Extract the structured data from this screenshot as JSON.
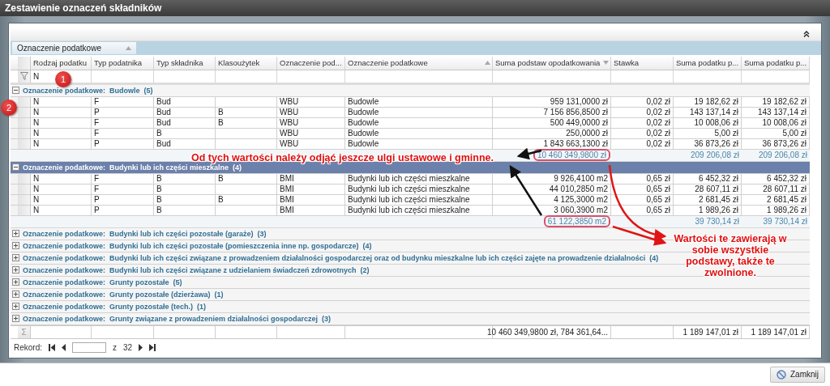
{
  "window": {
    "title": "Zestawienie oznaczeń składników"
  },
  "group_panel": {
    "label": "Oznaczenie podatkowe",
    "sort_ascending": true
  },
  "table": {
    "columns": [
      {
        "label": "Rodzaj podatku"
      },
      {
        "label": "Typ podatnika"
      },
      {
        "label": "Typ składnika"
      },
      {
        "label": "Klasoużytek"
      },
      {
        "label": "Oznaczenie pod..."
      },
      {
        "label": "Oznaczenie podatkowe",
        "sort_ascending": true
      },
      {
        "label": "Suma podstaw opodatkowania",
        "sort_ascending": false
      },
      {
        "label": "Stawka"
      },
      {
        "label": "Suma podatku p..."
      },
      {
        "label": "Suma podatku p..."
      }
    ],
    "filter": {
      "value": "N"
    },
    "groups": [
      {
        "title": "Oznaczenie podatkowe:  Budowle  (5)",
        "expanded": true,
        "selected": false,
        "rows": [
          {
            "rodzaj_podatku": "N",
            "typ_podatnika": "F",
            "typ_skladnika": "Bud",
            "column_5": "WBU",
            "oznaczenie_podatkowe": "Budowle",
            "suma_podstaw": "959 131,0000 zł",
            "stawka": "0,02 zł",
            "suma_podatku_1": "19 182,62 zł",
            "suma_podatku_2": "19 182,62 zł"
          },
          {
            "rodzaj_podatku": "N",
            "typ_podatnika": "P",
            "typ_skladnika": "Bud",
            "klasouzytek": "B",
            "column_5": "WBU",
            "oznaczenie_podatkowe": "Budowle",
            "suma_podstaw": "7 156 856,8500 zł",
            "stawka": "0,02 zł",
            "suma_podatku_1": "143 137,14 zł",
            "suma_podatku_2": "143 137,14 zł"
          },
          {
            "rodzaj_podatku": "N",
            "typ_podatnika": "F",
            "typ_skladnika": "Bud",
            "klasouzytek": "B",
            "column_5": "WBU",
            "oznaczenie_podatkowe": "Budowle",
            "suma_podstaw": "500 449,0000 zł",
            "stawka": "0,02 zł",
            "suma_podatku_1": "10 008,06 zł",
            "suma_podatku_2": "10 008,06 zł"
          },
          {
            "rodzaj_podatku": "N",
            "typ_podatnika": "F",
            "typ_skladnika": "B",
            "column_5": "WBU",
            "oznaczenie_podatkowe": "Budowle",
            "suma_podstaw": "250,0000 zł",
            "stawka": "0,02 zł",
            "suma_podatku_1": "5,00 zł",
            "suma_podatku_2": "5,00 zł"
          },
          {
            "rodzaj_podatku": "N",
            "typ_podatnika": "P",
            "typ_skladnika": "Bud",
            "column_5": "WBU",
            "oznaczenie_podatkowe": "Budowle",
            "suma_podstaw": "1 843 663,1300 zł",
            "stawka": "0,02 zł",
            "suma_podatku_1": "36 873,26 zł",
            "suma_podatku_2": "36 873,26 zł"
          }
        ],
        "summary": {
          "suma_podstaw": {
            "text": "10 460 349,9800 zł",
            "circled": true
          },
          "suma_podatku_1": {
            "text": "209 206,08 zł",
            "circled": false
          },
          "suma_podatku_2": {
            "text": "209 206,08 zł",
            "circled": false
          }
        }
      },
      {
        "title": "Oznaczenie podatkowe:  Budynki lub ich części mieszkalne  (4)",
        "expanded": true,
        "selected": true,
        "rows": [
          {
            "rodzaj_podatku": "N",
            "typ_podatnika": "F",
            "typ_skladnika": "B",
            "klasouzytek": "B",
            "column_5": "BMI",
            "oznaczenie_podatkowe": "Budynki lub ich części mieszkalne",
            "suma_podstaw": "9 926,4100 m2",
            "stawka": "0,65 zł",
            "suma_podatku_1": "6 452,32 zł",
            "suma_podatku_2": "6 452,32 zł"
          },
          {
            "rodzaj_podatku": "N",
            "typ_podatnika": "F",
            "typ_skladnika": "B",
            "column_5": "BMI",
            "oznaczenie_podatkowe": "Budynki lub ich części mieszkalne",
            "suma_podstaw": "44 010,2850 m2",
            "stawka": "0,65 zł",
            "suma_podatku_1": "28 607,11 zł",
            "suma_podatku_2": "28 607,11 zł"
          },
          {
            "rodzaj_podatku": "N",
            "typ_podatnika": "P",
            "typ_skladnika": "B",
            "klasouzytek": "B",
            "column_5": "BMI",
            "oznaczenie_podatkowe": "Budynki lub ich części mieszkalne",
            "suma_podstaw": "4 125,3000 m2",
            "stawka": "0,65 zł",
            "suma_podatku_1": "2 681,45 zł",
            "suma_podatku_2": "2 681,45 zł"
          },
          {
            "rodzaj_podatku": "N",
            "typ_podatnika": "P",
            "typ_skladnika": "B",
            "column_5": "BMI",
            "oznaczenie_podatkowe": "Budynki lub ich części mieszkalne",
            "suma_podstaw": "3 060,3900 m2",
            "stawka": "0,65 zł",
            "suma_podatku_1": "1 989,26 zł",
            "suma_podatku_2": "1 989,26 zł"
          }
        ],
        "summary": {
          "suma_podstaw": {
            "text": "61 122,3850 m2",
            "circled": true
          },
          "suma_podatku_1": {
            "text": "39 730,14 zł",
            "circled": false
          },
          "suma_podatku_2": {
            "text": "39 730,14 zł",
            "circled": false
          }
        }
      },
      {
        "title": "Oznaczenie podatkowe:  Budynki lub ich części pozostałe (garaże)  (3)",
        "expanded": false,
        "selected": false
      },
      {
        "title": "Oznaczenie podatkowe:  Budynki lub ich części pozostałe (pomieszczenia inne np. gospodarcze)  (4)",
        "expanded": false,
        "selected": false
      },
      {
        "title": "Oznaczenie podatkowe:  Budynki lub ich części związane z prowadzeniem działalności gospodarczej oraz od budynku mieszkalne lub ich części zajęte na prowadzenie działalności  (4)",
        "expanded": false,
        "selected": false
      },
      {
        "title": "Oznaczenie podatkowe:  Budynki lub ich części związane z udzielaniem świadczeń zdrowotnych  (2)",
        "expanded": false,
        "selected": false
      },
      {
        "title": "Oznaczenie podatkowe:  Grunty pozostałe  (5)",
        "expanded": false,
        "selected": false
      },
      {
        "title": "Oznaczenie podatkowe:  Grunty pozostałe (dzierżawa)  (1)",
        "expanded": false,
        "selected": false
      },
      {
        "title": "Oznaczenie podatkowe:  Grunty pozostałe (tech.)  (1)",
        "expanded": false,
        "selected": false
      },
      {
        "title": "Oznaczenie podatkowe:  Grunty związane z prowadzeniem działalności gospodarczej  (3)",
        "expanded": false,
        "selected": false
      }
    ],
    "footer": {
      "symbol": "Σ",
      "sums": {
        "suma_podstaw": "10 460 349,9800 zł, 784 361,64...",
        "suma_podatku_1": "1 189 147,01 zł",
        "suma_podatku_2": "1 189 147,01 zł"
      }
    }
  },
  "navigator": {
    "label": "Rekord:",
    "of": "z",
    "total": "32"
  },
  "annotations": {
    "markers": [
      "1",
      "2"
    ],
    "callouts": [
      "Od tych wartości należy odjąć jeszcze ulgi ustawowe i gminne.",
      "Wartości te zawierają w sobie wszystkie podstawy, także te zwolnione."
    ]
  },
  "buttons": [
    {
      "label": "Zamknij"
    }
  ]
}
